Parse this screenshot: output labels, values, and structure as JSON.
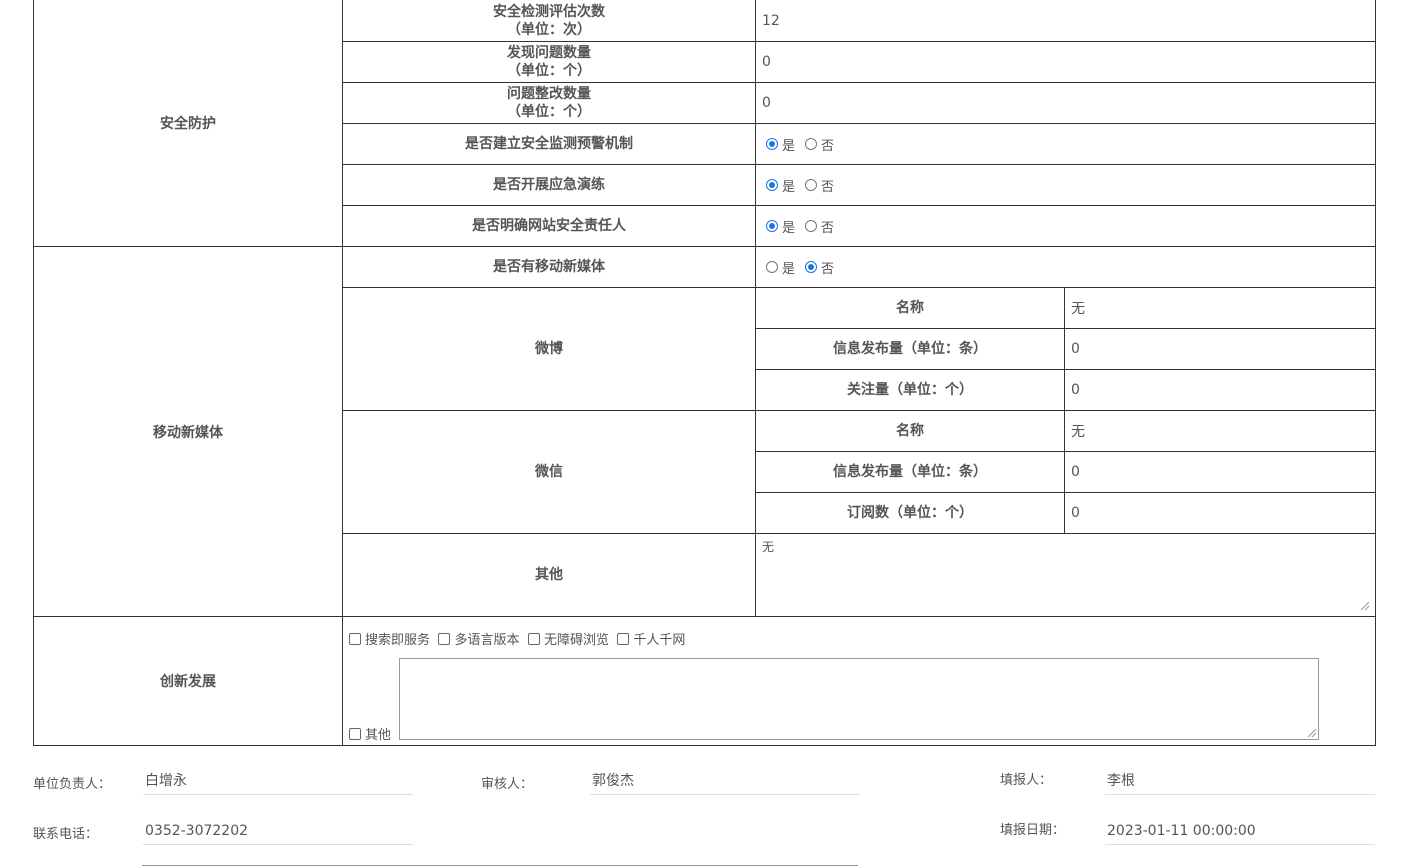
{
  "security": {
    "category": "安全防护",
    "assess_count": {
      "label1": "安全检测评估次数",
      "label2": "（单位：次）",
      "value": "12"
    },
    "issues_found": {
      "label1": "发现问题数量",
      "label2": "（单位：个）",
      "value": "0"
    },
    "issues_fixed": {
      "label1": "问题整改数量",
      "label2": "（单位：个）",
      "value": "0"
    },
    "monitor_mechanism": {
      "label": "是否建立安全监测预警机制",
      "yes": "是",
      "no": "否",
      "selected": "yes"
    },
    "emergency_drill": {
      "label": "是否开展应急演练",
      "yes": "是",
      "no": "否",
      "selected": "yes"
    },
    "security_owner": {
      "label": "是否明确网站安全责任人",
      "yes": "是",
      "no": "否",
      "selected": "yes"
    }
  },
  "media": {
    "category": "移动新媒体",
    "has_media": {
      "label": "是否有移动新媒体",
      "yes": "是",
      "no": "否",
      "selected": "no"
    },
    "weibo": {
      "label": "微博",
      "name_label": "名称",
      "name_value": "无",
      "posts_label": "信息发布量（单位：条）",
      "posts_value": "0",
      "follow_label": "关注量（单位：个）",
      "follow_value": "0"
    },
    "wechat": {
      "label": "微信",
      "name_label": "名称",
      "name_value": "无",
      "posts_label": "信息发布量（单位：条）",
      "posts_value": "0",
      "sub_label": "订阅数（单位：个）",
      "sub_value": "0"
    },
    "other": {
      "label": "其他",
      "value": "无"
    }
  },
  "innovation": {
    "category": "创新发展",
    "options": [
      "搜索即服务",
      "多语言版本",
      "无障碍浏览",
      "千人千网"
    ],
    "other_label": "其他"
  },
  "footer": {
    "leader_label": "单位负责人：",
    "leader_value": "白增永",
    "reviewer_label": "审核人：",
    "reviewer_value": "郭俊杰",
    "filler_label": "填报人：",
    "filler_value": "李根",
    "phone_label": "联系电话：",
    "phone_value": "0352-3072202",
    "date_label": "填报日期：",
    "date_value": "2023-01-11 00:00:00"
  },
  "colors": {
    "accent": "#1a73e8",
    "border": "#333333",
    "text": "#555555"
  }
}
